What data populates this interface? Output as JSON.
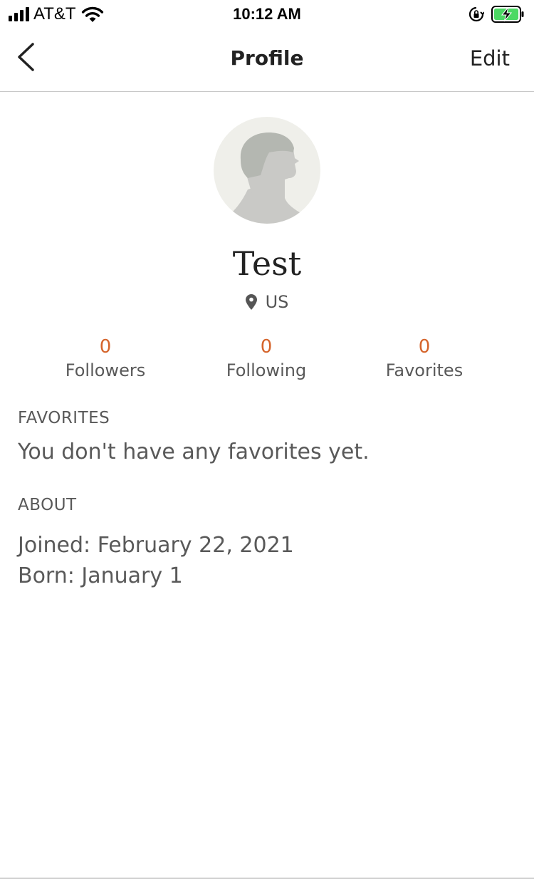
{
  "status_bar": {
    "carrier": "AT&T",
    "time": "10:12 AM"
  },
  "nav": {
    "title": "Profile",
    "edit_label": "Edit"
  },
  "profile": {
    "name": "Test",
    "location": "US"
  },
  "stats": [
    {
      "count": "0",
      "label": "Followers"
    },
    {
      "count": "0",
      "label": "Following"
    },
    {
      "count": "0",
      "label": "Favorites"
    }
  ],
  "favorites": {
    "heading": "FAVORITES",
    "empty_text": "You don't have any favorites yet."
  },
  "about": {
    "heading": "ABOUT",
    "joined": "Joined: February 22, 2021",
    "born": "Born: January 1"
  },
  "colors": {
    "accent": "#d5642b",
    "text_secondary": "#595959",
    "battery_green": "#4cd964",
    "avatar_bg": "#efefea",
    "avatar_figure": "#c9c9c6"
  }
}
